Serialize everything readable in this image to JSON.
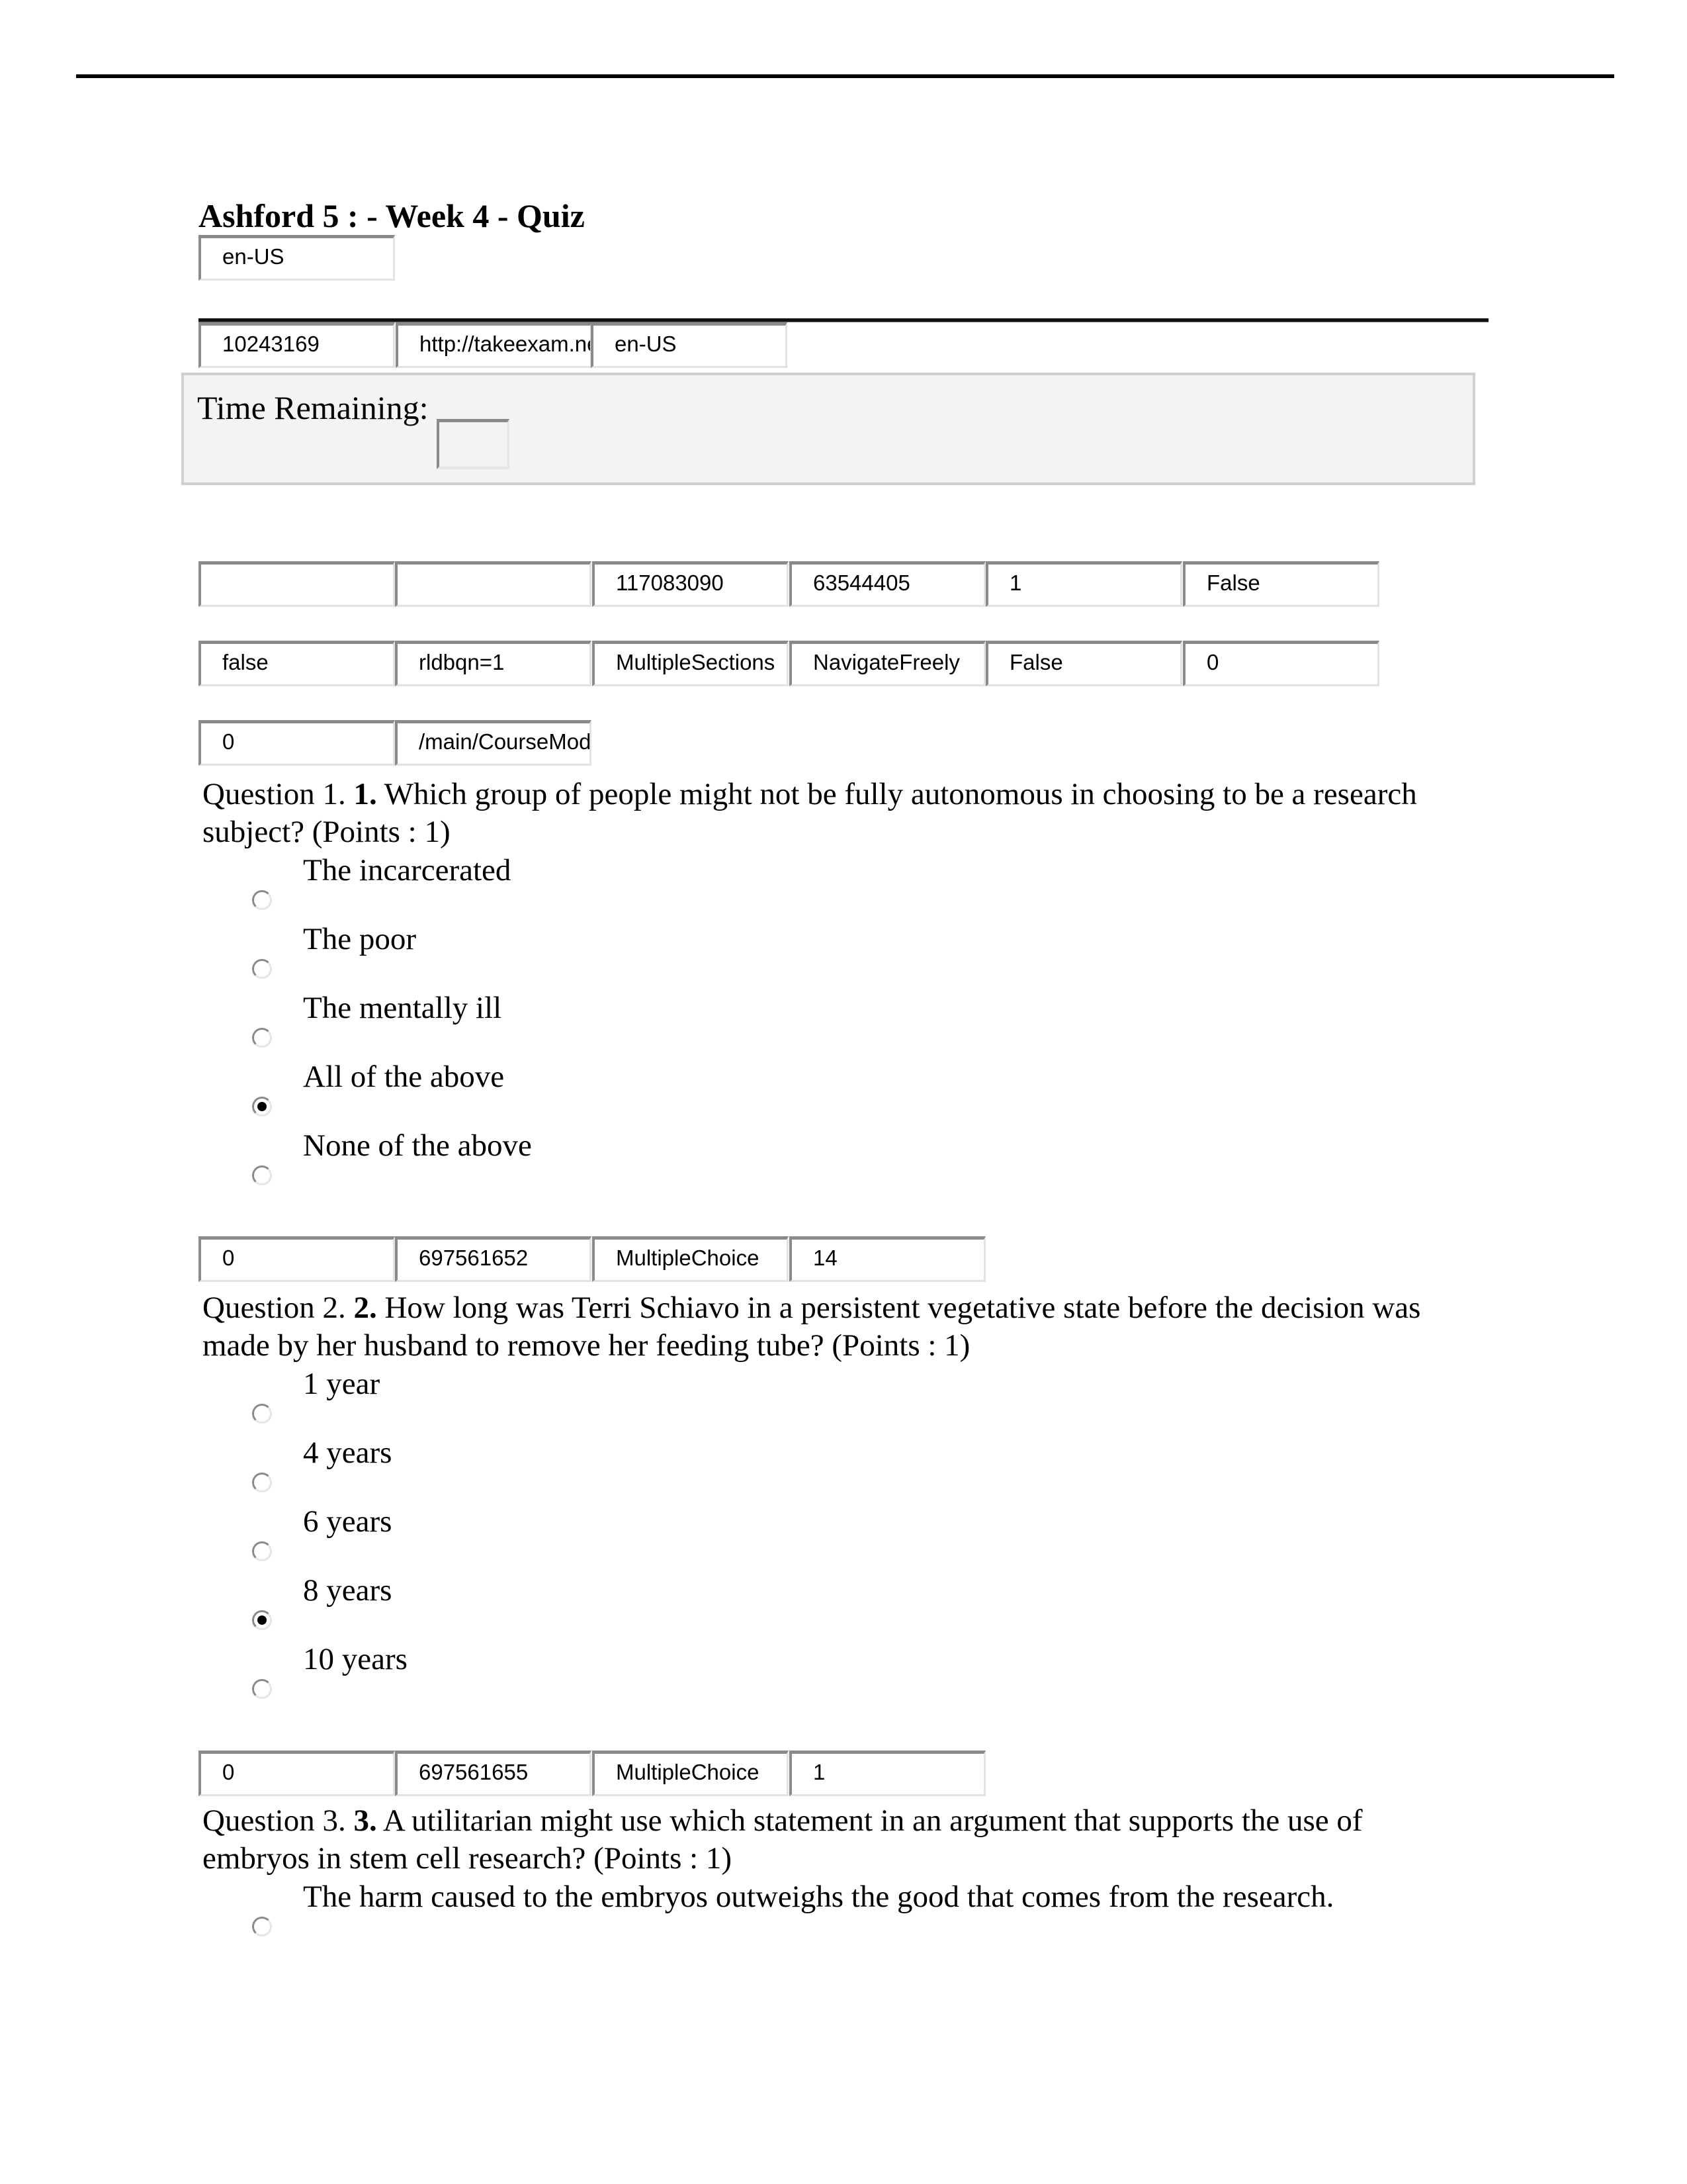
{
  "page": {
    "title": "Ashford 5 : - Week 4 - Quiz",
    "locale_field": "en-US"
  },
  "header_fields": [
    "10243169",
    "http://takeexam.ne",
    "en-US"
  ],
  "timer": {
    "label": "Time Remaining:",
    "value": ""
  },
  "hidden_rows": [
    [
      "",
      "",
      "117083090",
      "63544405",
      "1",
      "False"
    ],
    [
      "false",
      "rldbqn=1",
      "MultipleSections",
      "NavigateFreely",
      "False",
      "0"
    ],
    [
      "0",
      "/main/CourseMod"
    ]
  ],
  "questions": [
    {
      "prefix": "Question 1.",
      "number": "1.",
      "text": "Which group of people might not be fully autonomous in choosing to be a research subject? (Points : 1)",
      "options": [
        {
          "label": "The incarcerated",
          "selected": false
        },
        {
          "label": "The poor",
          "selected": false
        },
        {
          "label": "The mentally ill",
          "selected": false
        },
        {
          "label": "All of the above",
          "selected": true
        },
        {
          "label": "None of the above",
          "selected": false
        }
      ],
      "after_fields": [
        "0",
        "697561652",
        "MultipleChoice",
        "14"
      ]
    },
    {
      "prefix": "Question 2.",
      "number": "2.",
      "text": "How long was Terri Schiavo in a persistent vegetative state before the decision was made by her husband to remove her feeding tube? (Points : 1)",
      "options": [
        {
          "label": "1 year",
          "selected": false
        },
        {
          "label": "4 years",
          "selected": false
        },
        {
          "label": "6 years",
          "selected": false
        },
        {
          "label": "8 years",
          "selected": true
        },
        {
          "label": "10 years",
          "selected": false
        }
      ],
      "after_fields": [
        "0",
        "697561655",
        "MultipleChoice",
        "1"
      ]
    },
    {
      "prefix": "Question 3.",
      "number": "3.",
      "text": "A utilitarian might use which statement in an argument that supports the use of embryos in stem cell research? (Points : 1)",
      "options": [
        {
          "label": "The harm caused to the embryos outweighs the good that comes from the research.",
          "selected": false
        }
      ],
      "after_fields": []
    }
  ]
}
